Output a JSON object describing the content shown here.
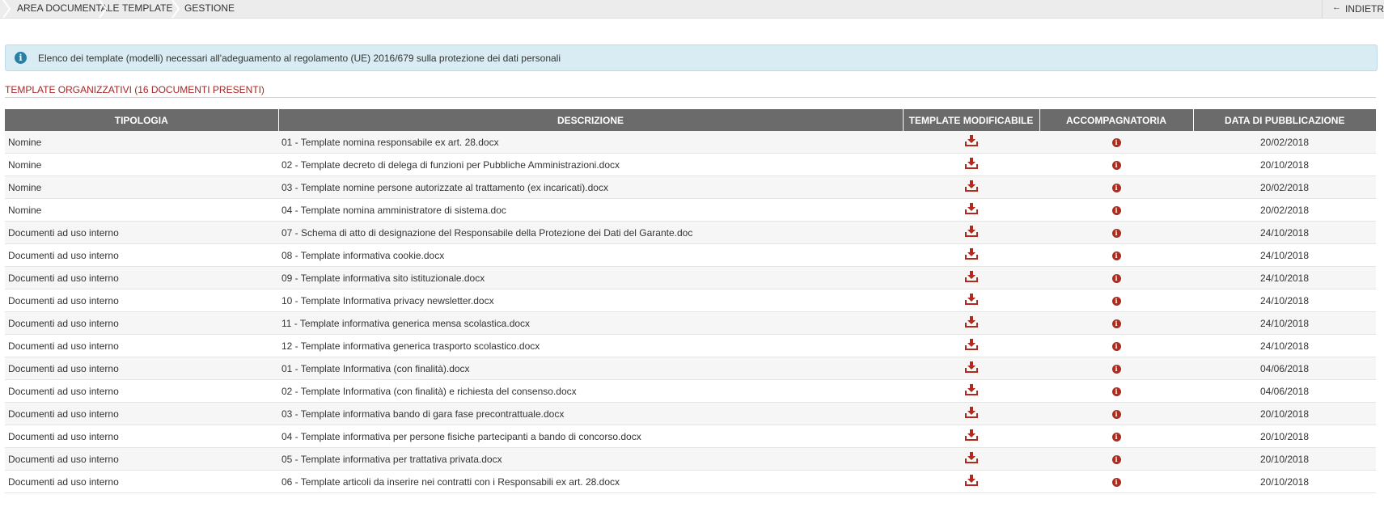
{
  "breadcrumb": [
    "AREA DOCUMENTALE",
    "TEMPLATE",
    "GESTIONE"
  ],
  "back_label": "INDIETRO",
  "info_message": "Elenco dei template (modelli) necessari all'adeguamento al regolamento (UE) 2016/679 sulla protezione dei dati personali",
  "section_title": "TEMPLATE ORGANIZZATIVI (16 DOCUMENTI PRESENTI)",
  "colors": {
    "accent": "#a62626",
    "icon": "#b02a1e",
    "header_bg": "#6b6b6b",
    "info_bg": "#d9ecf3"
  },
  "table": {
    "headers": [
      "TIPOLOGIA",
      "DESCRIZIONE",
      "TEMPLATE MODIFICABILE",
      "ACCOMPAGNATORIA",
      "DATA DI PUBBLICAZIONE"
    ],
    "icons": {
      "modificabile": "download-icon",
      "accompagnatoria": "info-icon"
    },
    "rows": [
      {
        "tipologia": "Nomine",
        "descrizione": "01 - Template nomina responsabile ex art. 28.docx",
        "data": "20/02/2018"
      },
      {
        "tipologia": "Nomine",
        "descrizione": "02 - Template decreto di delega di funzioni per Pubbliche Amministrazioni.docx",
        "data": "20/10/2018"
      },
      {
        "tipologia": "Nomine",
        "descrizione": "03 - Template nomine persone autorizzate al trattamento (ex incaricati).docx",
        "data": "20/02/2018"
      },
      {
        "tipologia": "Nomine",
        "descrizione": "04 - Template nomina amministratore di sistema.doc",
        "data": "20/02/2018"
      },
      {
        "tipologia": "Documenti ad uso interno",
        "descrizione": "07 - Schema di atto di designazione del Responsabile della Protezione dei Dati del Garante.doc",
        "data": "24/10/2018"
      },
      {
        "tipologia": "Documenti ad uso interno",
        "descrizione": "08 - Template informativa cookie.docx",
        "data": "24/10/2018"
      },
      {
        "tipologia": "Documenti ad uso interno",
        "descrizione": "09 - Template informativa sito istituzionale.docx",
        "data": "24/10/2018"
      },
      {
        "tipologia": "Documenti ad uso interno",
        "descrizione": "10 - Template Informativa privacy newsletter.docx",
        "data": "24/10/2018"
      },
      {
        "tipologia": "Documenti ad uso interno",
        "descrizione": "11 - Template informativa generica mensa scolastica.docx",
        "data": "24/10/2018"
      },
      {
        "tipologia": "Documenti ad uso interno",
        "descrizione": "12 - Template informativa generica trasporto scolastico.docx",
        "data": "24/10/2018"
      },
      {
        "tipologia": "Documenti ad uso interno",
        "descrizione": "01 - Template Informativa (con finalità).docx",
        "data": "04/06/2018"
      },
      {
        "tipologia": "Documenti ad uso interno",
        "descrizione": "02 - Template Informativa (con finalità) e richiesta del consenso.docx",
        "data": "04/06/2018"
      },
      {
        "tipologia": "Documenti ad uso interno",
        "descrizione": "03 - Template informativa bando di gara fase precontrattuale.docx",
        "data": "20/10/2018"
      },
      {
        "tipologia": "Documenti ad uso interno",
        "descrizione": "04 - Template informativa per persone fisiche partecipanti a bando di concorso.docx",
        "data": "20/10/2018"
      },
      {
        "tipologia": "Documenti ad uso interno",
        "descrizione": "05 - Template informativa per trattativa privata.docx",
        "data": "20/10/2018"
      },
      {
        "tipologia": "Documenti ad uso interno",
        "descrizione": "06 - Template articoli da inserire nei contratti con i Responsabili ex art. 28.docx",
        "data": "20/10/2018"
      }
    ]
  }
}
